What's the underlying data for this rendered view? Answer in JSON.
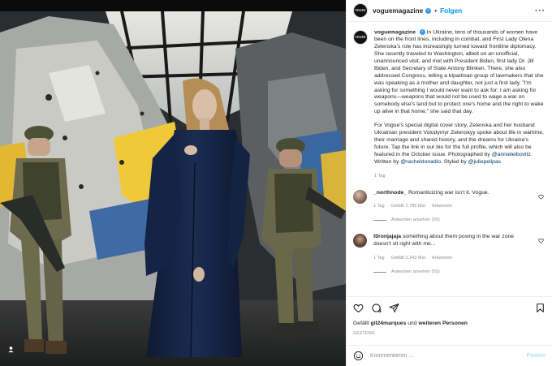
{
  "account": {
    "username": "voguemagazine",
    "avatar_text": "VOGUE",
    "verified": true,
    "follow_label": "Folgen"
  },
  "caption": {
    "username": "voguemagazine",
    "paragraph1": "In Ukraine, tens of thousands of women have been on the front lines, including in combat, and First Lady Olena Zelenska's role has increasingly turned toward frontline diplomacy. She recently traveled to Washington, albeit on an unofficial, unannounced visit, and met with President Biden, first lady Dr. Jill Biden, and Secretary of State Antony Blinken. There, she also addressed Congress, telling a bipartisan group of lawmakers that she was speaking as a mother and daughter, not just a first lady. \"I'm asking for something I would never want to ask for; I am asking for weapons—weapons that would not be used to wage a war on somebody else's land but to protect one's home and the right to wake up alive in that home,\" she said that day.",
    "paragraph2": "For Vogue's special digital cover story, Zelenska and her husband Ukrainian president Volodymyr Zelenskyy spoke about life in wartime, their marriage and shared history, and the dreams for Ukraine's future. Tap the link in our bio for the full profile, which will also be featured in the October issue. Photographed by",
    "mention_photographer": "@annieleibovitz",
    "written_by": ". Written by",
    "mention_writer": "@racheldonadio",
    "styled_by": ". Styled by",
    "mention_stylist": "@juliepelipas",
    "time": "1 Tag"
  },
  "comments": [
    {
      "username": "_northnode_",
      "text": "Romanticizing war isn't it. Vogue.",
      "time": "1 Tag",
      "likes": "Gefällt 1.789 Mal",
      "reply_label": "Antworten",
      "view_replies": "Antworten ansehen (55)"
    },
    {
      "username": "t0ronjajaja",
      "text": "something about them posing in the war zone doesn't sit right with me...",
      "time": "1 Tag",
      "likes": "Gefällt 2.343 Mal",
      "reply_label": "Antworten",
      "view_replies": "Antworten ansehen (55)"
    }
  ],
  "likes": {
    "prefix": "Gefällt",
    "user": "gil24marques",
    "connector": "und",
    "others": "weiteren Personen"
  },
  "posted_when": "GESTERN",
  "add_comment": {
    "placeholder": "Kommentieren ...",
    "post_label": "Posten"
  },
  "icons": {
    "more": "more-horizontal-icon",
    "heart": "heart-icon",
    "comment": "comment-bubble-icon",
    "share": "paper-plane-icon",
    "save": "bookmark-icon",
    "emoji": "emoji-smile-icon",
    "photo_user": "user-tag-icon"
  },
  "colors": {
    "link_blue": "#0095f6",
    "mention": "#00376b",
    "meta_gray": "#8e8e8e",
    "verified": "#3897f0"
  }
}
